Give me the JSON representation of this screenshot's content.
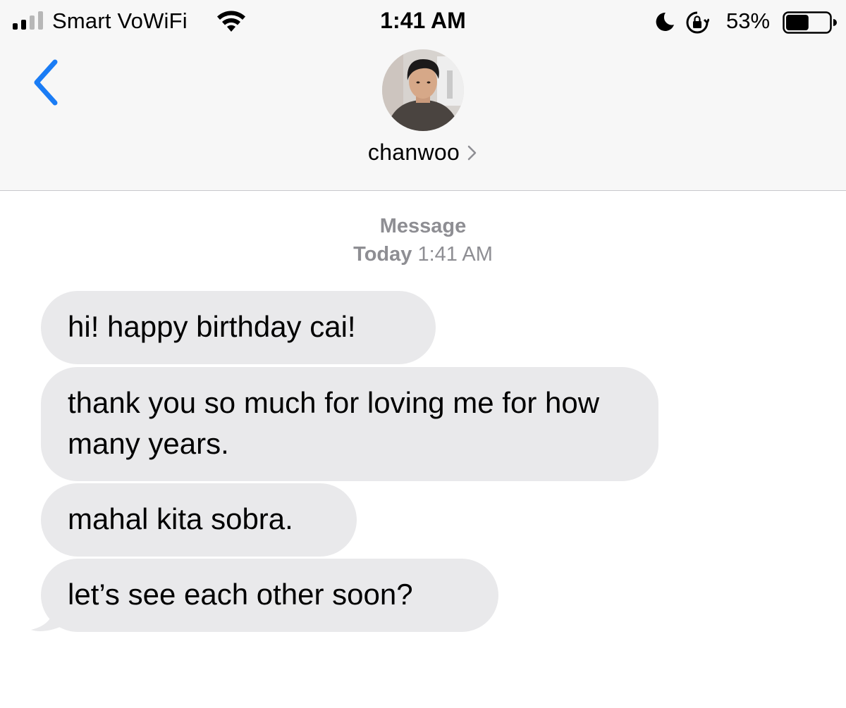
{
  "status_bar": {
    "carrier": "Smart VoWiFi",
    "time": "1:41 AM",
    "battery_percent": "53%",
    "battery_level": 0.53,
    "signal_bars_filled": 2,
    "signal_bars_total": 4,
    "icons": [
      "signal-icon",
      "wifi-icon",
      "moon-icon",
      "rotation-lock-icon",
      "battery-icon"
    ]
  },
  "header": {
    "back_icon": "chevron-left-icon",
    "contact_name": "chanwoo",
    "contact_chevron_icon": "chevron-right-icon",
    "accent_color": "#1a7cf5"
  },
  "conversation": {
    "service_label": "Message",
    "timestamp_day": "Today",
    "timestamp_time": "1:41 AM",
    "messages": [
      {
        "sender": "contact",
        "text": "hi! happy birthday cai!"
      },
      {
        "sender": "contact",
        "text": "thank you so much for loving me for how many years."
      },
      {
        "sender": "contact",
        "text": "mahal kita sobra."
      },
      {
        "sender": "contact",
        "text": "let’s see each other soon?"
      }
    ],
    "bubble_color": "#e9e9eb"
  }
}
